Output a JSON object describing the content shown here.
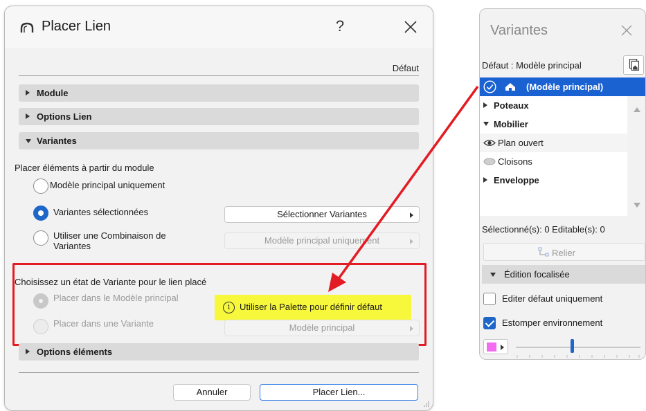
{
  "dialog": {
    "title": "Placer Lien",
    "help_label": "?",
    "default_label": "Défaut",
    "sections": {
      "module": "Module",
      "options_lien": "Options Lien",
      "variantes": "Variantes",
      "options_elements": "Options éléments"
    },
    "place_from_label": "Placer éléments à partir du module",
    "radio_main_only": "Modèle principal uniquement",
    "radio_selected_variants": "Variantes sélectionnées",
    "radio_combination_line1": "Utiliser une Combinaison de",
    "radio_combination_line2": "Variantes",
    "select_variants_button": "Sélectionner Variantes",
    "combination_dropdown": "Modèle principal uniquement",
    "state_label": "Choisissez un état de Variante pour le lien placé",
    "radio_place_main": "Placer dans le Modèle principal",
    "radio_place_variant": "Placer dans une Variante",
    "variant_dropdown": "Modèle principal",
    "tip_icon": "i",
    "tip_text": "Utiliser la Palette pour définir défaut",
    "cancel_button": "Annuler",
    "place_button": "Placer Lien...",
    "tip_color": "#f7f73c",
    "frame_color": "#e31b23",
    "accent_color": "#1e67c9"
  },
  "palette": {
    "title": "Variantes",
    "default_text": "Défaut : Modèle principal",
    "items": [
      {
        "label": "(Modèle principal)",
        "icon": "house-icon",
        "selected": true
      },
      {
        "label": "Poteaux",
        "icon": "triangle-right-icon",
        "selected": false
      },
      {
        "label": "Mobilier",
        "icon": "triangle-down-icon",
        "selected": false
      },
      {
        "label": "Plan ouvert",
        "icon": "eye-icon",
        "selected": false
      },
      {
        "label": "Cloisons",
        "icon": "eye-closed-icon",
        "selected": false
      },
      {
        "label": "Enveloppe",
        "icon": "triangle-right-icon",
        "selected": false
      }
    ],
    "selection_count": "Sélectionné(s): 0 Editable(s): 0",
    "relier_button": "Relier",
    "focus_section": "Édition focalisée",
    "edit_default_only": "Editer défaut uniquement",
    "edit_default_checked": false,
    "fade_environment": "Estomper environnement",
    "fade_environment_checked": true,
    "fade_color": "#f26bf0",
    "slider_level": 0.45,
    "selected_row_color": "#1a62d2"
  }
}
